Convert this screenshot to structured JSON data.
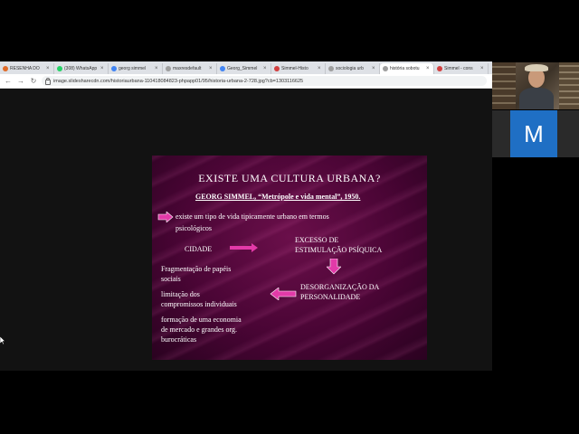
{
  "browser": {
    "tabs": [
      {
        "label": "RESENHA DO",
        "color": "#e06c2a"
      },
      {
        "label": "(308) WhatsApp",
        "color": "#25d366"
      },
      {
        "label": "georg simmel",
        "color": "#4285f4"
      },
      {
        "label": "maxresdefault",
        "color": "#9e9e9e"
      },
      {
        "label": "Georg_Simmel",
        "color": "#4285f4"
      },
      {
        "label": "Simmel-Histo",
        "color": "#d23f3f"
      },
      {
        "label": "sociologia urb",
        "color": "#9e9e9e"
      },
      {
        "label": "história sobotu",
        "color": "#9e9e9e"
      },
      {
        "label": "Simmel - cons",
        "color": "#d23f3f"
      }
    ],
    "active_tab_index": 7,
    "url": "image.slidesharecdn.com/historiaurbana-110418084823-phpapp01/95/historia-urbana-2-728.jpg?cb=1303116625"
  },
  "slide": {
    "title": "EXISTE UMA CULTURA URBANA?",
    "subtitle": "GEORG SIMMEL, “Metrópole e vida mental”, 1950.",
    "line1a": "existe um tipo de vida tipicamente urbano em termos",
    "line1b": "psicológicos",
    "cidade": "CIDADE",
    "excesso_a": "EXCESSO DE",
    "excesso_b": "ESTIMULAÇÃO PSÍQUICA",
    "desorg_a": "DESORGANIZAÇÃO DA",
    "desorg_b": "PERSONALIDADE",
    "item1a": "Fragmentação de papéis",
    "item1b": "sociais",
    "item2a": "limitação dos",
    "item2b": "compromissos individuais",
    "item3a": "formação de uma economia",
    "item3b": "de mercado e grandes org.",
    "item3c": "burocráticas"
  },
  "meeting": {
    "participant_initial": "M"
  },
  "colors": {
    "arrow": "#e23aa8",
    "avatar": "#1f6fc4"
  }
}
